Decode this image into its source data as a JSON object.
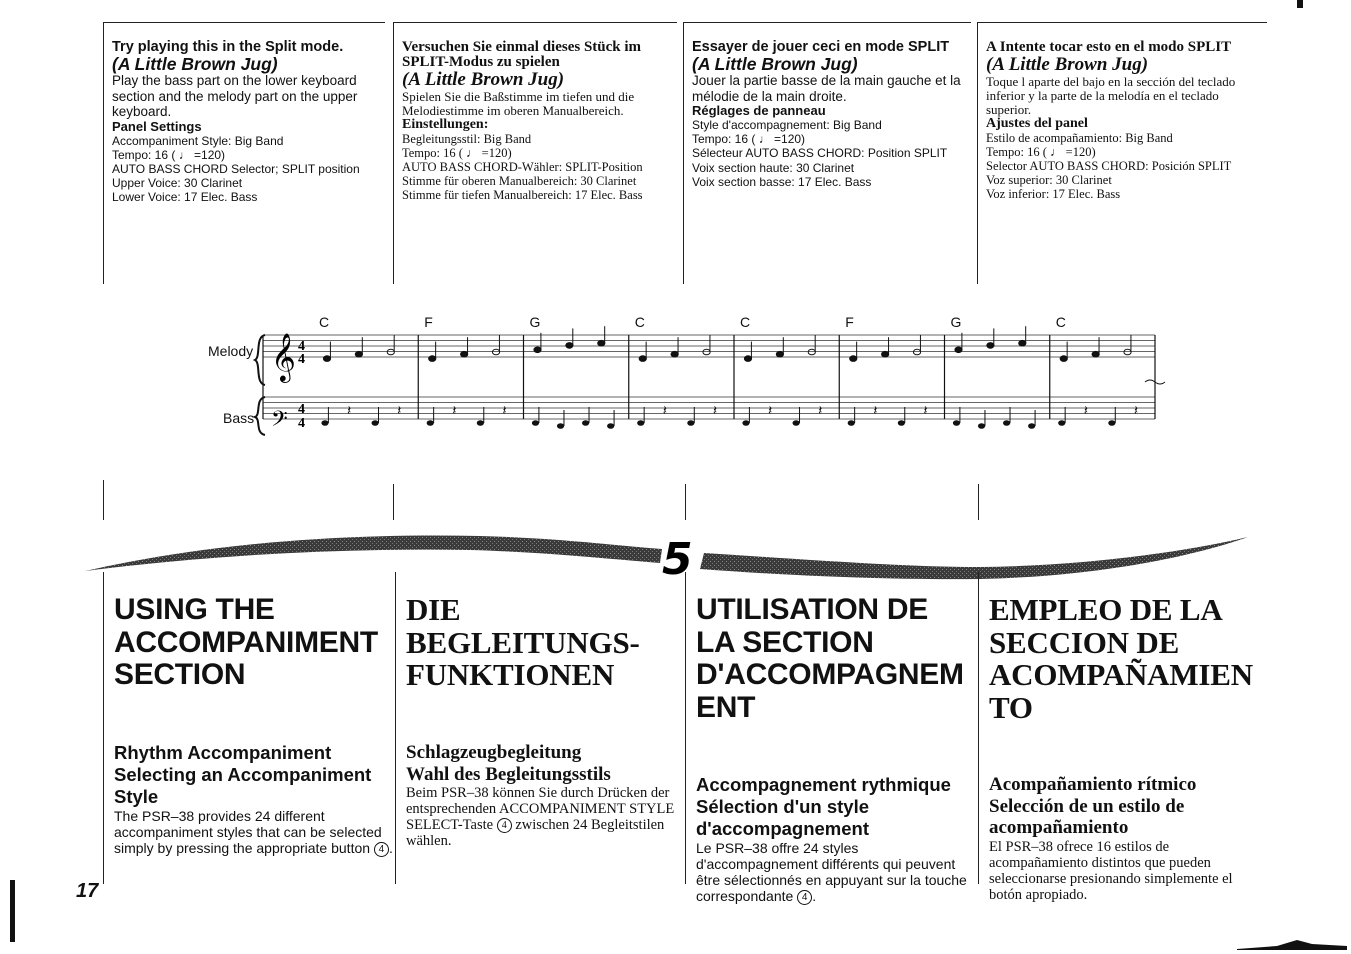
{
  "page": {
    "number": "17",
    "chapter_number": "5"
  },
  "split_mode": {
    "english": {
      "heading": "Try playing this in the Split mode.",
      "song": "(A Little Brown Jug)",
      "description": "Play the bass part on the lower keyboard section and the melody part on the upper keyboard.",
      "settings_label": "Panel Settings",
      "settings": [
        "Accompaniment Style: Big Band",
        "Tempo: 16 ( ♩ =120)",
        "AUTO BASS CHORD Selector; SPLIT position",
        "Upper Voice: 30 Clarinet",
        "Lower Voice: 17 Elec. Bass"
      ]
    },
    "german": {
      "heading": "Versuchen Sie einmal dieses Stück im SPLIT-Modus zu spielen",
      "song": "(A Little Brown Jug)",
      "description": "Spielen Sie die Baßstimme im tiefen und die Melodiestimme im oberen Manualbereich.",
      "settings_label": "Einstellungen:",
      "settings": [
        "Begleitungsstil: Big Band",
        "Tempo: 16 ( ♩ =120)",
        "AUTO BASS CHORD-Wähler: SPLIT-Position",
        "Stimme für oberen Manualbereich: 30 Clarinet",
        "Stimme für tiefen Manualbereich: 17 Elec. Bass"
      ]
    },
    "french": {
      "heading": "Essayer de jouer ceci en mode SPLIT",
      "song": "(A Little Brown Jug)",
      "description": "Jouer la partie basse de la main gauche et la mélodie de la main droite.",
      "settings_label": "Réglages de panneau",
      "settings": [
        "Style d'accompagnement: Big Band",
        "Tempo: 16 ( ♩ =120)",
        "Sélecteur AUTO BASS CHORD: Position SPLIT",
        "Voix section haute: 30 Clarinet",
        "Voix section basse: 17 Elec. Bass"
      ]
    },
    "spanish": {
      "heading": "A Intente tocar esto en el modo SPLIT",
      "song": "(A Little Brown Jug)",
      "description": "Toque l aparte del bajo en la sección del teclado inferior y la parte de la melodía en el teclado superior.",
      "settings_label": "Ajustes del panel",
      "settings": [
        "Estilo de acompañamiento: Big Band",
        "Tempo: 16 ( ♩ =120)",
        "Selector AUTO BASS CHORD: Posición SPLIT",
        "Voz superior: 30 Clarinet",
        "Voz inferior: 17 Elec. Bass"
      ]
    }
  },
  "score": {
    "melody_label": "Melody",
    "bass_label": "Bass",
    "time_signature": "4/4",
    "chords": [
      "C",
      "F",
      "G",
      "C",
      "C",
      "F",
      "G",
      "C"
    ]
  },
  "chapter": {
    "english": {
      "title_lines": [
        "USING THE",
        "ACCOMPANIMENT",
        "SECTION"
      ],
      "section_heading": "Rhythm Accompaniment",
      "subsection_heading": "Selecting an Accompaniment Style",
      "body": "The PSR–38 provides 24 different accompaniment styles that can be selected simply by pressing the appropriate button",
      "button_ref": "4",
      "body_end": "."
    },
    "german": {
      "title_lines": [
        "DIE",
        "BEGLEITUNGS-",
        "FUNKTIONEN"
      ],
      "section_heading": "Schlagzeugbegleitung",
      "subsection_heading": "Wahl des Begleitungsstils",
      "body": "Beim PSR–38 können Sie durch Drücken der entsprechenden ACCOMPANIMENT STYLE SELECT-Taste",
      "button_ref": "4",
      "body_end": "zwischen 24 Begleitstilen wählen."
    },
    "french": {
      "title_lines": [
        "UTILISATION DE",
        "LA SECTION",
        "D'ACCOMPAGNEM",
        "ENT"
      ],
      "section_heading": "Accompagnement rythmique",
      "subsection_heading": "Sélection d'un style d'accompagnement",
      "body": "Le PSR–38 offre 24 styles d'accompagnement différents qui peuvent être sélectionnés en appuyant sur la touche correspondante",
      "button_ref": "4",
      "body_end": "."
    },
    "spanish": {
      "title_lines": [
        "EMPLEO DE LA",
        "SECCION DE",
        "ACOMPAÑAMIEN",
        "TO"
      ],
      "section_heading": "Acompañamiento rítmico",
      "subsection_heading": "Selección de un estilo de acompañamiento",
      "body": "El PSR–38 ofrece 16 estilos de acompañamiento distintos que pueden seleccionarse presionando simplemente el botón apropiado."
    }
  }
}
